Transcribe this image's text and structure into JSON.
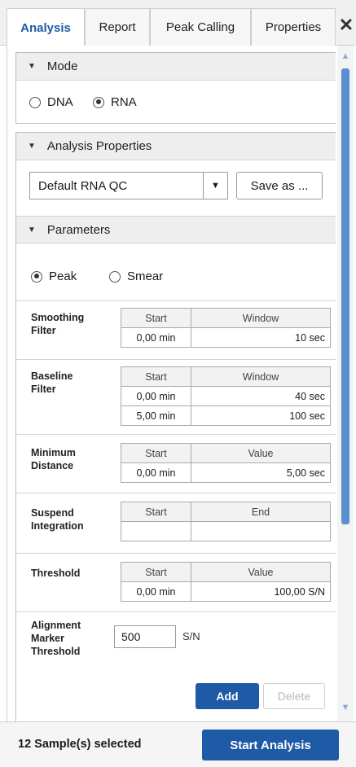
{
  "tabs": [
    {
      "label": "Analysis",
      "active": true
    },
    {
      "label": "Report",
      "active": false
    },
    {
      "label": "Peak Calling",
      "active": false
    },
    {
      "label": "Properties",
      "active": false
    }
  ],
  "close_glyph": "✕",
  "mode": {
    "title": "Mode",
    "options": [
      {
        "label": "DNA",
        "selected": false
      },
      {
        "label": "RNA",
        "selected": true
      }
    ]
  },
  "analysis_properties": {
    "title": "Analysis Properties",
    "preset_value": "Default RNA QC",
    "save_as_label": "Save as ...",
    "parameters_title": "Parameters",
    "peak_type": [
      {
        "label": "Peak",
        "selected": true
      },
      {
        "label": "Smear",
        "selected": false
      }
    ],
    "smoothing": {
      "label_line1": "Smoothing",
      "label_line2": "Filter",
      "col1": "Start",
      "col2": "Window",
      "rows": [
        {
          "start": "0,00 min",
          "value": "10 sec"
        }
      ]
    },
    "baseline": {
      "label_line1": "Baseline",
      "label_line2": "Filter",
      "col1": "Start",
      "col2": "Window",
      "rows": [
        {
          "start": "0,00 min",
          "value": "40 sec"
        },
        {
          "start": "5,00 min",
          "value": "100 sec"
        }
      ]
    },
    "min_distance": {
      "label_line1": "Minimum",
      "label_line2": "Distance",
      "col1": "Start",
      "col2": "Value",
      "rows": [
        {
          "start": "0,00 min",
          "value": "5,00 sec"
        }
      ]
    },
    "suspend": {
      "label_line1": "Suspend",
      "label_line2": "Integration",
      "col1": "Start",
      "col2": "End",
      "rows": [
        {
          "start": "",
          "value": ""
        }
      ]
    },
    "threshold": {
      "label_line1": "Threshold",
      "col1": "Start",
      "col2": "Value",
      "rows": [
        {
          "start": "0,00 min",
          "value": "100,00 S/N"
        }
      ]
    },
    "alignment": {
      "label_line1": "Alignment",
      "label_line2": "Marker",
      "label_line3": "Threshold",
      "value": "500",
      "unit": "S/N"
    },
    "add_label": "Add",
    "delete_label": "Delete"
  },
  "footer": {
    "status": "12 Sample(s) selected",
    "start_label": "Start Analysis"
  },
  "colors": {
    "accent": "#1f5aa6",
    "scroll_thumb": "#5a8fd0"
  }
}
